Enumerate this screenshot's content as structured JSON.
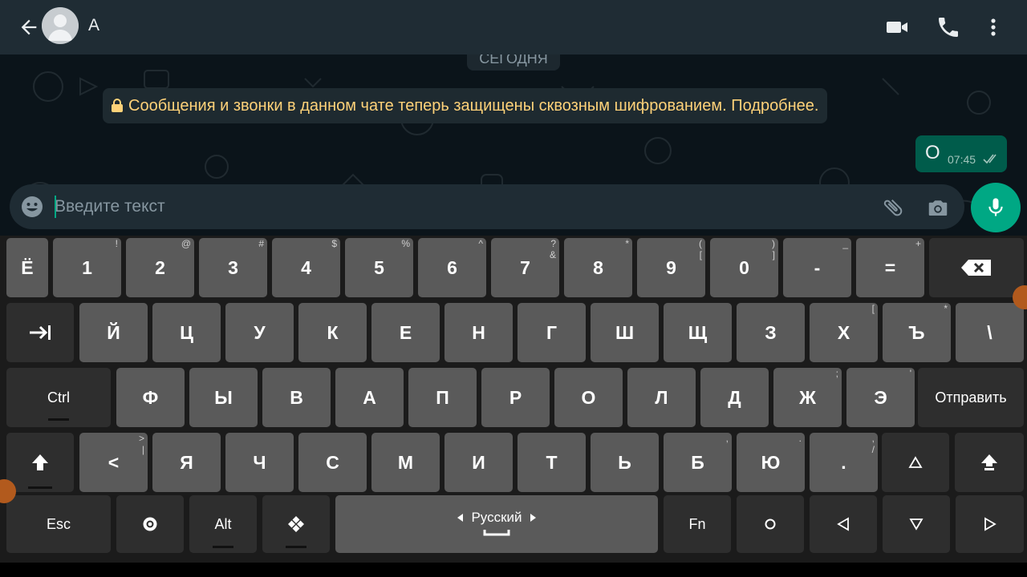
{
  "header": {
    "contact_name": "А",
    "icons": [
      "back-arrow-icon",
      "video-call-icon",
      "phone-call-icon",
      "more-vert-icon"
    ]
  },
  "chat": {
    "date_label": "СЕГОДНЯ",
    "encryption_notice": "Сообщения и звонки в данном чате теперь защищены сквозным шифрованием. Подробнее.",
    "messages": [
      {
        "text": "О",
        "time": "07:45",
        "status": "read"
      }
    ]
  },
  "composer": {
    "placeholder": "Введите текст",
    "value": ""
  },
  "keyboard": {
    "row1": [
      {
        "label": "Ё",
        "sub": ""
      },
      {
        "label": "1",
        "sub": "!"
      },
      {
        "label": "2",
        "sub": "@"
      },
      {
        "label": "3",
        "sub": "#"
      },
      {
        "label": "4",
        "sub": "$"
      },
      {
        "label": "5",
        "sub": "%"
      },
      {
        "label": "6",
        "sub": "^"
      },
      {
        "label": "7",
        "sub": "?\n&"
      },
      {
        "label": "8",
        "sub": "*"
      },
      {
        "label": "9",
        "sub": "(\n["
      },
      {
        "label": "0",
        "sub": ")\n]"
      },
      {
        "label": "-",
        "sub": "_"
      },
      {
        "label": "=",
        "sub": "+"
      }
    ],
    "row2": [
      {
        "label": "Й"
      },
      {
        "label": "Ц"
      },
      {
        "label": "У"
      },
      {
        "label": "К"
      },
      {
        "label": "Е"
      },
      {
        "label": "Н"
      },
      {
        "label": "Г"
      },
      {
        "label": "Ш"
      },
      {
        "label": "Щ"
      },
      {
        "label": "З"
      },
      {
        "label": "Х",
        "sub": "["
      },
      {
        "label": "Ъ",
        "sub": "*"
      },
      {
        "label": "\\"
      }
    ],
    "row3": [
      {
        "label": "Ф"
      },
      {
        "label": "Ы"
      },
      {
        "label": "В"
      },
      {
        "label": "А"
      },
      {
        "label": "П"
      },
      {
        "label": "Р"
      },
      {
        "label": "О"
      },
      {
        "label": "Л"
      },
      {
        "label": "Д"
      },
      {
        "label": "Ж",
        "sub": ";"
      },
      {
        "label": "Э",
        "sub": "'"
      }
    ],
    "row4": [
      {
        "label": "<",
        "sub": ">\n|"
      },
      {
        "label": "Я"
      },
      {
        "label": "Ч"
      },
      {
        "label": "С"
      },
      {
        "label": "М"
      },
      {
        "label": "И"
      },
      {
        "label": "Т"
      },
      {
        "label": "Ь"
      },
      {
        "label": "Б",
        "sub": ","
      },
      {
        "label": "Ю",
        "sub": "."
      },
      {
        "label": ".",
        "sub": ",\n/"
      }
    ],
    "ctrl_label": "Ctrl",
    "send_label": "Отправить",
    "esc_label": "Esc",
    "alt_label": "Alt",
    "language_label": "Русский",
    "fn_label": "Fn"
  }
}
